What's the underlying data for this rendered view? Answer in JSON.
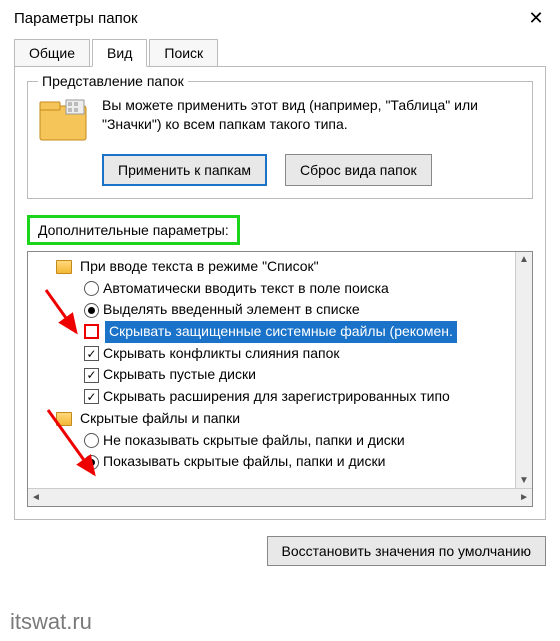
{
  "window": {
    "title": "Параметры папок"
  },
  "tabs": {
    "general": "Общие",
    "view": "Вид",
    "search": "Поиск"
  },
  "folderview": {
    "legend": "Представление папок",
    "text": "Вы можете применить этот вид (например, \"Таблица\" или \"Значки\") ко всем папкам такого типа.",
    "apply": "Применить к папкам",
    "reset": "Сброс вида папок"
  },
  "advanced": {
    "label": "Дополнительные параметры:",
    "items": [
      {
        "kind": "group",
        "label": "При вводе текста в режиме \"Список\""
      },
      {
        "kind": "radio",
        "selected": false,
        "label": "Автоматически вводить текст в поле поиска"
      },
      {
        "kind": "radio",
        "selected": true,
        "label": "Выделять введенный элемент в списке"
      },
      {
        "kind": "check",
        "checked": false,
        "highlight": true,
        "redbox": true,
        "label": "Скрывать защищенные системные файлы (рекомен."
      },
      {
        "kind": "check",
        "checked": true,
        "label": "Скрывать конфликты слияния папок"
      },
      {
        "kind": "check",
        "checked": true,
        "label": "Скрывать пустые диски"
      },
      {
        "kind": "check",
        "checked": true,
        "label": "Скрывать расширения для зарегистрированных типо"
      },
      {
        "kind": "group",
        "label": "Скрытые файлы и папки"
      },
      {
        "kind": "radio",
        "selected": false,
        "label": "Не показывать скрытые файлы, папки и диски"
      },
      {
        "kind": "radio",
        "selected": true,
        "label": "Показывать скрытые файлы, папки и диски"
      }
    ]
  },
  "footer": {
    "restore": "Восстановить значения по умолчанию"
  },
  "watermark": "itswat.ru"
}
